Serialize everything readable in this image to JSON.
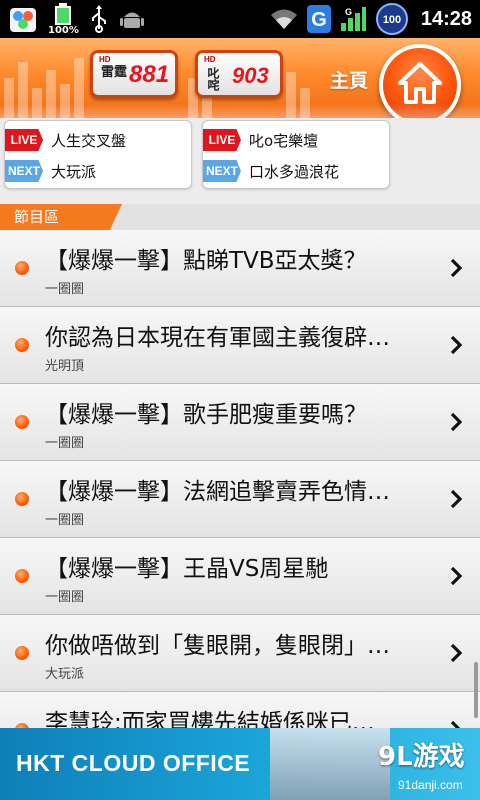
{
  "status_bar": {
    "battery_percent": "100%",
    "battery_level": "100",
    "time": "14:28",
    "icons": [
      "app-store-icon",
      "battery-icon",
      "usb-icon",
      "android-debug-icon",
      "wifi-icon",
      "google-icon",
      "signal-icon",
      "battery-level-icon"
    ]
  },
  "header": {
    "station1": {
      "hd": "HD",
      "name": "雷霆",
      "number": "881"
    },
    "station2": {
      "hd": "HD",
      "name": "叱咤",
      "number": "903"
    },
    "home_label": "主頁"
  },
  "now_playing": [
    {
      "live_tag": "LIVE",
      "live_program": "人生交叉盤",
      "next_tag": "NEXT",
      "next_program": "大玩派"
    },
    {
      "live_tag": "LIVE",
      "live_program": "叱o宅樂壇",
      "next_tag": "NEXT",
      "next_program": "口水多過浪花"
    }
  ],
  "section": {
    "label": "節目區"
  },
  "list": [
    {
      "title": "【爆爆一擊】點睇TVB亞太獎？",
      "program": "一圈圈"
    },
    {
      "title": "你認為日本現在有軍國主義復辟…",
      "program": "光明頂"
    },
    {
      "title": "【爆爆一擊】歌手肥瘦重要嗎？",
      "program": "一圈圈"
    },
    {
      "title": "【爆爆一擊】法網追擊賣弄色情…",
      "program": "一圈圈"
    },
    {
      "title": "【爆爆一擊】王晶VS周星馳",
      "program": "一圈圈"
    },
    {
      "title": "你做唔做到「隻眼開，隻眼閉」…",
      "program": "大玩派"
    },
    {
      "title": "李慧玲:而家買樓先結婚係咪已…",
      "program": ""
    }
  ],
  "banner": {
    "text": "HKT CLOUD OFFICE",
    "watermark_logo": "9L游戏",
    "watermark_url": "91danji.com"
  },
  "colors": {
    "accent": "#f57a1f",
    "live": "#e0161c",
    "next": "#5aa6e6",
    "banner": "#1aa5d8"
  }
}
